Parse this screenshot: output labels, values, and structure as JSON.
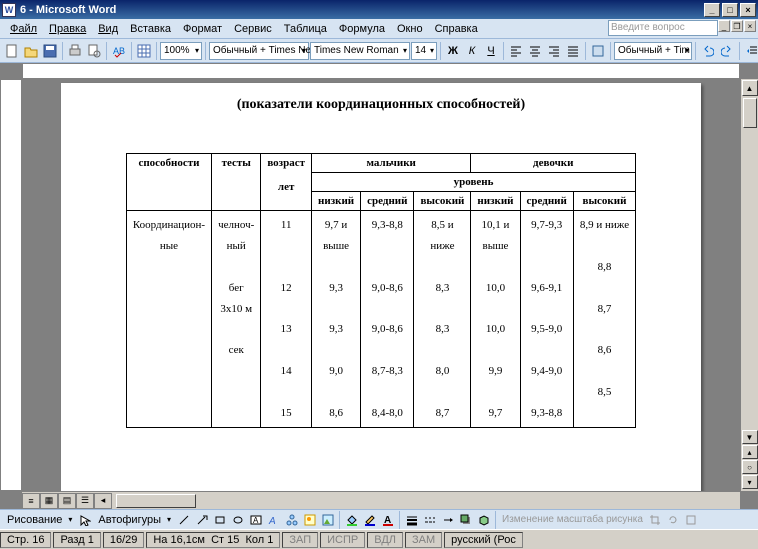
{
  "title": "6 - Microsoft Word",
  "app_icon_letter": "W",
  "menu": [
    "Файл",
    "Правка",
    "Вид",
    "Вставка",
    "Формат",
    "Сервис",
    "Таблица",
    "Формула",
    "Окно",
    "Справка"
  ],
  "ask_placeholder": "Введите вопрос",
  "toolbar": {
    "zoom": "100%",
    "style": "Обычный + Times Ne",
    "font": "Times New Roman",
    "size": "14",
    "style2": "Обычный + Tim"
  },
  "page_heading": "(показатели координационных способностей)",
  "table": {
    "h_ability": "способности",
    "h_tests": "тесты",
    "h_age": "возраст",
    "h_age2": "лет",
    "h_boys": "мальчики",
    "h_girls": "девочки",
    "h_level": "уровень",
    "h_low": "низкий",
    "h_mid": "средний",
    "h_high": "высокий",
    "row": {
      "ability": "Координацион-\nные",
      "test": "челноч-\nный\n\nбег\n3х10 м\n\nсек",
      "ages": "11\n\n\n12\n\n13\n\n14\n\n15",
      "b_low": "9,7 и\nвыше\n\n9,3\n\n9,3\n\n9,0\n\n8,6",
      "b_mid": "9,3-8,8\n\n\n9,0-8,6\n\n9,0-8,6\n\n8,7-8,3\n\n8,4-8,0",
      "b_high": "8,5 и\nниже\n\n8,3\n\n8,3\n\n8,0\n\n8,7",
      "g_low": "10,1 и\nвыше\n\n10,0\n\n10,0\n\n9,9\n\n9,7",
      "g_mid": "9,7-9,3\n\n\n9,6-9,1\n\n9,5-9,0\n\n9,4-9,0\n\n9,3-8,8",
      "g_high": "8,9 и ниже\n\n8,8\n\n8,7\n\n8,6\n\n8,5"
    }
  },
  "drawbar": {
    "draw": "Рисование",
    "autoshapes": "Автофигуры",
    "disabled": "Изменение масштаба рисунка"
  },
  "status": {
    "page": "Стр. 16",
    "sect": "Разд 1",
    "pages": "16/29",
    "at": "На 16,1см",
    "ln": "Ст 15",
    "col": "Кол 1",
    "rec": "ЗАП",
    "fix": "ИСПР",
    "ext": "ВДЛ",
    "ovr": "ЗАМ",
    "lang": "русский (Рос"
  },
  "chart_data": {
    "type": "table",
    "title": "(показатели координационных способностей)",
    "columns": [
      "способности",
      "тесты",
      "возраст лет",
      "мальчики низкий",
      "мальчики средний",
      "мальчики высокий",
      "девочки низкий",
      "девочки средний",
      "девочки высокий"
    ],
    "rows": [
      [
        "Координационные",
        "челночный бег 3х10 м сек",
        11,
        "9,7 и выше",
        "9,3-8,8",
        "8,5 и ниже",
        "10,1 и выше",
        "9,7-9,3",
        "8,9 и ниже"
      ],
      [
        "",
        "",
        12,
        "9,3",
        "9,0-8,6",
        "8,3",
        "10,0",
        "9,6-9,1",
        "8,8"
      ],
      [
        "",
        "",
        13,
        "9,3",
        "9,0-8,6",
        "8,3",
        "10,0",
        "9,5-9,0",
        "8,7"
      ],
      [
        "",
        "",
        14,
        "9,0",
        "8,7-8,3",
        "8,0",
        "9,9",
        "9,4-9,0",
        "8,6"
      ],
      [
        "",
        "",
        15,
        "8,6",
        "8,4-8,0",
        "8,7",
        "9,7",
        "9,3-8,8",
        "8,5"
      ]
    ]
  }
}
